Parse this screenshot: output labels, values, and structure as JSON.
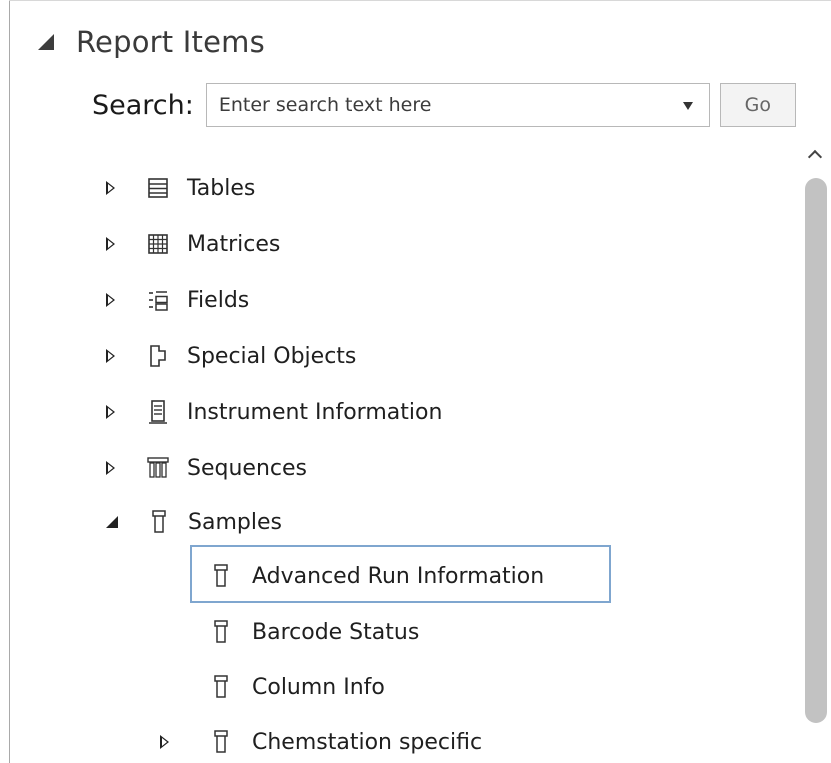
{
  "panel": {
    "title": "Report Items"
  },
  "search": {
    "label": "Search:",
    "placeholder": "Enter search text here",
    "go_label": "Go"
  },
  "tree": {
    "items": [
      {
        "label": "Tables",
        "icon": "table-icon",
        "expanded": false
      },
      {
        "label": "Matrices",
        "icon": "matrix-grid-icon",
        "expanded": false
      },
      {
        "label": "Fields",
        "icon": "fields-icon",
        "expanded": false
      },
      {
        "label": "Special Objects",
        "icon": "special-object-icon",
        "expanded": false
      },
      {
        "label": "Instrument Information",
        "icon": "instrument-icon",
        "expanded": false
      },
      {
        "label": "Sequences",
        "icon": "sequences-icon",
        "expanded": false
      },
      {
        "label": "Samples",
        "icon": "sample-vial-icon",
        "expanded": true
      }
    ],
    "samples_children": [
      {
        "label": "Advanced Run Information",
        "icon": "sample-vial-icon",
        "selected": true
      },
      {
        "label": "Barcode Status",
        "icon": "sample-vial-icon",
        "selected": false
      },
      {
        "label": "Column Info",
        "icon": "sample-vial-icon",
        "selected": false
      },
      {
        "label": "Chemstation specific",
        "icon": "sample-vial-icon",
        "selected": false,
        "has_children": true
      }
    ]
  },
  "colors": {
    "selection_border": "#7fa6cf",
    "scrollbar_thumb": "#c2c2c2"
  }
}
